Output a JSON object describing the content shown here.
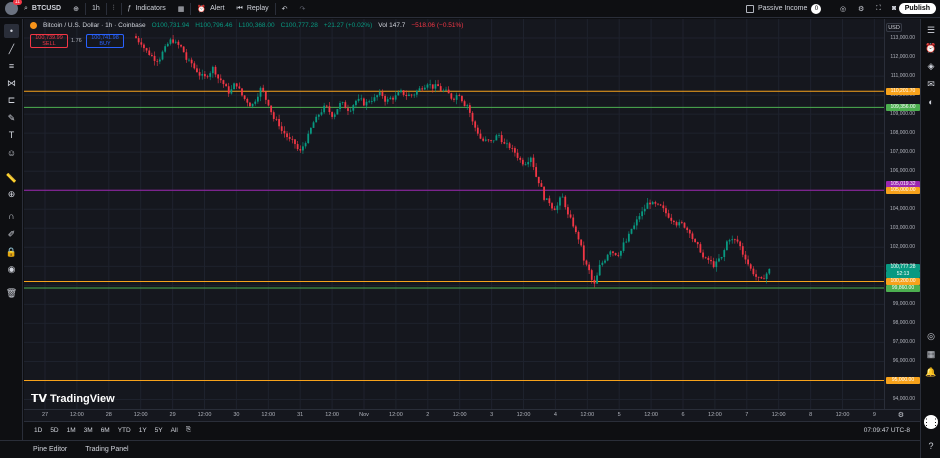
{
  "topbar": {
    "avatar_badge": "11",
    "symbol": "BTCUSD",
    "interval": "1h",
    "indicators": "Indicators",
    "alert": "Alert",
    "replay": "Replay",
    "passive_income": "Passive Income",
    "passive_income_value": "0",
    "publish": "Publish"
  },
  "legend": {
    "title": "Bitcoin / U.S. Dollar · 1h · Coinbase",
    "open": "O100,731.94",
    "high": "H100,796.46",
    "low": "L100,368.00",
    "close": "C100,777.28",
    "change": "+21.27 (+0.02%)",
    "volume": "Vol 147.7",
    "vol_change": "−518.06 (−0.51%)",
    "sell_price": "100,739.99",
    "sell_label": "SELL",
    "spread": "1.76",
    "buy_price": "100,741.98",
    "buy_label": "BUY"
  },
  "currency": "USD",
  "price_scale": {
    "ticks": [
      "113,000.00",
      "112,000.00",
      "111,000.00",
      "110,000.00",
      "109,000.00",
      "108,000.00",
      "107,000.00",
      "106,000.00",
      "105,000.00",
      "104,000.00",
      "103,000.00",
      "102,000.00",
      "101,000.00",
      "100,000.00",
      "99,000.00",
      "98,000.00",
      "97,000.00",
      "96,000.00",
      "95,000.00",
      "94,000.00"
    ],
    "labels": [
      {
        "text": "110,201.70",
        "color": "#f7a21b"
      },
      {
        "text": "109,356.00",
        "color": "#4caf50"
      },
      {
        "text": "105,019.32",
        "color": "#9c27b0"
      },
      {
        "text": "105,000.00",
        "color": "#f7a21b"
      },
      {
        "text": "100,777.28",
        "color": "#089981"
      },
      {
        "text": "52:13",
        "color": "#089981"
      },
      {
        "text": "100,200.00",
        "color": "#f7a21b"
      },
      {
        "text": "99,860.00",
        "color": "#4caf50"
      },
      {
        "text": "95,000.00",
        "color": "#f7a21b"
      }
    ]
  },
  "horizontal_lines": [
    {
      "price": 110201.7,
      "color": "#f7a21b"
    },
    {
      "price": 109356.0,
      "color": "#4caf50"
    },
    {
      "price": 105000.0,
      "color": "#9c27b0"
    },
    {
      "price": 100200.0,
      "color": "#f7a21b"
    },
    {
      "price": 99860.0,
      "color": "#4caf50"
    },
    {
      "price": 95000.0,
      "color": "#f7a21b"
    }
  ],
  "time_axis": {
    "ticks": [
      "27",
      "12:00",
      "28",
      "12:00",
      "29",
      "12:00",
      "30",
      "12:00",
      "31",
      "12:00",
      "Nov",
      "12:00",
      "2",
      "12:00",
      "3",
      "12:00",
      "4",
      "12:00",
      "5",
      "12:00",
      "6",
      "12:00",
      "7",
      "12:00",
      "8",
      "12:00",
      "9"
    ]
  },
  "rangebar": {
    "ranges": [
      "1D",
      "5D",
      "1M",
      "3M",
      "6M",
      "YTD",
      "1Y",
      "5Y",
      "All"
    ],
    "clock": "07:09:47 UTC-8"
  },
  "bottombar": {
    "pine_editor": "Pine Editor",
    "trading_panel": "Trading Panel"
  },
  "logo_text": "TradingView",
  "chart_data": {
    "type": "candlestick",
    "series_points_close": [
      112800,
      112200,
      111900,
      112400,
      112900,
      112500,
      111700,
      111300,
      110900,
      111400,
      110800,
      110200,
      110600,
      109800,
      109500,
      110300,
      109600,
      108600,
      108000,
      107500,
      107000,
      107800,
      108700,
      109300,
      109000,
      109500,
      109300,
      109700,
      109600,
      109800,
      110000,
      109700,
      109900,
      110100,
      110000,
      110300,
      110700,
      110400,
      110200,
      109900,
      110100,
      109500,
      108300,
      107600,
      107500,
      107900,
      107300,
      107000,
      106500,
      106800,
      105500,
      104400,
      104100,
      104600,
      103400,
      102500,
      101000,
      100000,
      101200,
      101900,
      101700,
      102300,
      103100,
      103800,
      104400,
      104100,
      103800,
      103500,
      103200,
      102900,
      102000,
      101300,
      101100,
      101400,
      102500,
      102300,
      101500,
      100700,
      100200,
      100777
    ]
  }
}
